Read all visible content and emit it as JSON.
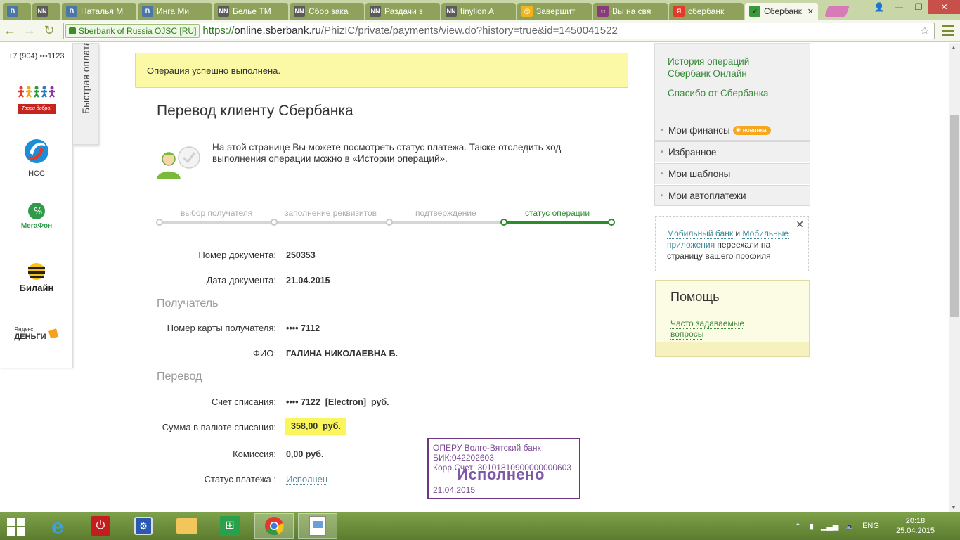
{
  "browser": {
    "tabs": [
      {
        "icon": "B",
        "icon_bg": "#4a76a8",
        "label": "",
        "active": false
      },
      {
        "icon": "NN",
        "icon_bg": "#5a5a5a",
        "label": "",
        "active": false
      },
      {
        "icon": "B",
        "icon_bg": "#4a76a8",
        "label": "Наталья М",
        "active": false
      },
      {
        "icon": "B",
        "icon_bg": "#4a76a8",
        "label": "Инга Ми",
        "active": false
      },
      {
        "icon": "NN",
        "icon_bg": "#5a5a5a",
        "label": "Белье ТМ",
        "active": false
      },
      {
        "icon": "NN",
        "icon_bg": "#5a5a5a",
        "label": "Сбор зака",
        "active": false
      },
      {
        "icon": "NN",
        "icon_bg": "#5a5a5a",
        "label": "Раздачи з",
        "active": false
      },
      {
        "icon": "NN",
        "icon_bg": "#5a5a5a",
        "label": "tinylion A",
        "active": false
      },
      {
        "icon": "@",
        "icon_bg": "#f2b418",
        "label": "Завершит",
        "active": false
      },
      {
        "icon": "ʊ",
        "icon_bg": "#8a3a7a",
        "label": "Вы на свя",
        "active": false
      },
      {
        "icon": "Я",
        "icon_bg": "#e53a2a",
        "label": "сбербанк",
        "active": false
      },
      {
        "icon": "✔",
        "icon_bg": "#3a9a3a",
        "label": "Сбербанк",
        "active": true
      }
    ],
    "cert_label": "Sberbank of Russia OJSC [RU]",
    "url_scheme": "https://",
    "url_host": "online.sberbank.ru",
    "url_path": "/PhizIC/private/payments/view.do?history=true&id=1450041522"
  },
  "left_panel": {
    "phone": "+7 (904) •••1123",
    "quickpay_label": "Быстрая оплата",
    "providers": [
      {
        "name": "",
        "caption": "Твори добро!"
      },
      {
        "name": "НСС"
      },
      {
        "name": "МегаФон"
      },
      {
        "name": "Билайн"
      },
      {
        "name": "Яндекс",
        "name2": "ДЕНЬГИ"
      }
    ]
  },
  "main": {
    "success_message": "Операция успешно выполнена.",
    "title": "Перевод клиенту Сбербанка",
    "info_text": "На этой странице Вы можете посмотреть статус платежа. Также отследить ход выполнения операции можно в «Истории операций».",
    "steps": [
      {
        "label": "выбор получателя",
        "active": false
      },
      {
        "label": "заполнение реквизитов",
        "active": false
      },
      {
        "label": "подтверждение",
        "active": false
      },
      {
        "label": "статус операции",
        "active": true
      }
    ],
    "doc_number_label": "Номер документа:",
    "doc_number": "250353",
    "doc_date_label": "Дата документа:",
    "doc_date": "21.04.2015",
    "recipient_section": "Получатель",
    "card_label": "Номер карты получателя:",
    "card_value": "•••• 7112",
    "fio_label": "ФИО:",
    "fio_value": "ГАЛИНА НИКОЛАЕВНА Б.",
    "transfer_section": "Перевод",
    "account_label": "Счет списания:",
    "account_value": "•••• 7122  [Electron]  руб.",
    "amount_label": "Сумма в валюте списания:",
    "amount_value": "358,00  руб.",
    "fee_label": "Комиссия:",
    "fee_value": "0,00 руб.",
    "status_label": "Статус платежа :",
    "status_value": "Исполнен"
  },
  "stamp": {
    "line1": "ОПЕРУ Волго-Вятский банк",
    "line2": "БИК:042202603",
    "line3": "Корр.Счет: 30101810900000000603",
    "big": "Исполнено",
    "date": "21.04.2015"
  },
  "right": {
    "history_link": "История операций Сбербанк Онлайн",
    "thanks_link": "Спасибо от Сбербанка",
    "menu": [
      {
        "label": "Мои финансы",
        "badge": "новинка"
      },
      {
        "label": "Избранное"
      },
      {
        "label": "Мои шаблоны"
      },
      {
        "label": "Мои автоплатежи"
      }
    ],
    "notice_link1": "Мобильный банк",
    "notice_and": " и ",
    "notice_link2": "Мобильные приложения",
    "notice_text": " переехали на страницу вашего профиля",
    "help_title": "Помощь",
    "help_link": "Часто задаваемые вопросы"
  },
  "taskbar": {
    "lang": "ENG",
    "time": "20:18",
    "date": "25.04.2015"
  }
}
